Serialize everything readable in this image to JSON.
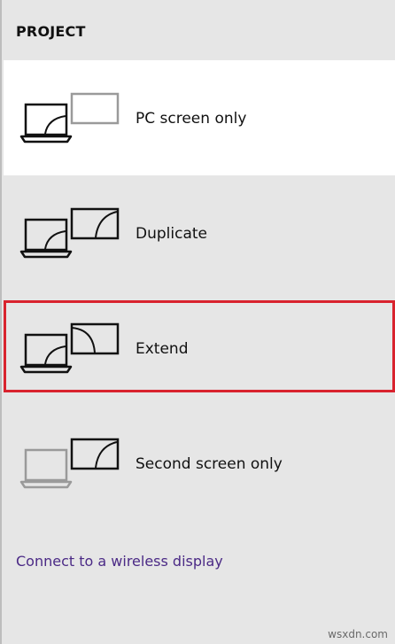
{
  "header": {
    "title": "PROJECT"
  },
  "options": [
    {
      "label": "PC screen only",
      "icon": "pc-screen-only-icon"
    },
    {
      "label": "Duplicate",
      "icon": "duplicate-icon"
    },
    {
      "label": "Extend",
      "icon": "extend-icon",
      "selected": true
    },
    {
      "label": "Second screen only",
      "icon": "second-screen-only-icon"
    }
  ],
  "footer": {
    "link_label": "Connect to a wireless display"
  },
  "watermark": "wsxdn.com",
  "colors": {
    "panel_bg": "#e6e6e6",
    "hover_bg": "#ffffff",
    "selection_border": "#d9232e",
    "link": "#4b2a86",
    "disabled_icon": "#9a9a9a",
    "icon": "#111111"
  }
}
